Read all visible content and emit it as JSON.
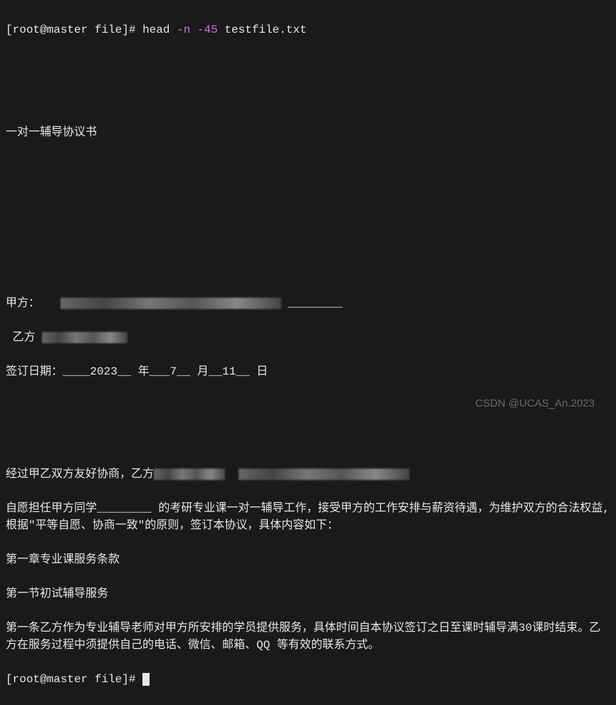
{
  "prompt": {
    "user": "root",
    "host": "master",
    "dir": "file",
    "symbol": "#"
  },
  "command": {
    "cmd": "head",
    "opt1": "-n",
    "opt2": "-45",
    "file": "testfile.txt"
  },
  "output": {
    "title": "一对一辅导协议书",
    "jiafang_label": "甲方：",
    "jiafang_redacted_suffix": "________",
    "yifang_label": " 乙方 ",
    "date_label": "签订日期：",
    "date_year": "____2023__",
    "date_year_unit": "年",
    "date_month": "___7__",
    "date_month_unit": "月",
    "date_day": "__11__",
    "date_day_unit": " 日",
    "para1_prefix": "经过甲乙双方友好协商，乙方",
    "para2": "自愿担任甲方同学________ 的考研专业课一对一辅导工作，接受甲方的工作安排与薪资待遇，为维护双方的合法权益,根据\"平等自愿、协商一致\"的原则，签订本协议，具体内容如下：",
    "chapter1": "第一章专业课服务条款",
    "section1": "第一节初试辅导服务",
    "article1": "第一条乙方作为专业辅导老师对甲方所安排的学员提供服务，具体时间自本协议签订之日至课时辅导满30课时结束。乙方在服务过程中须提供自己的电话、微信、邮箱、QQ 等有效的联系方式。"
  },
  "watermark": "CSDN @UCAS_An.2023"
}
